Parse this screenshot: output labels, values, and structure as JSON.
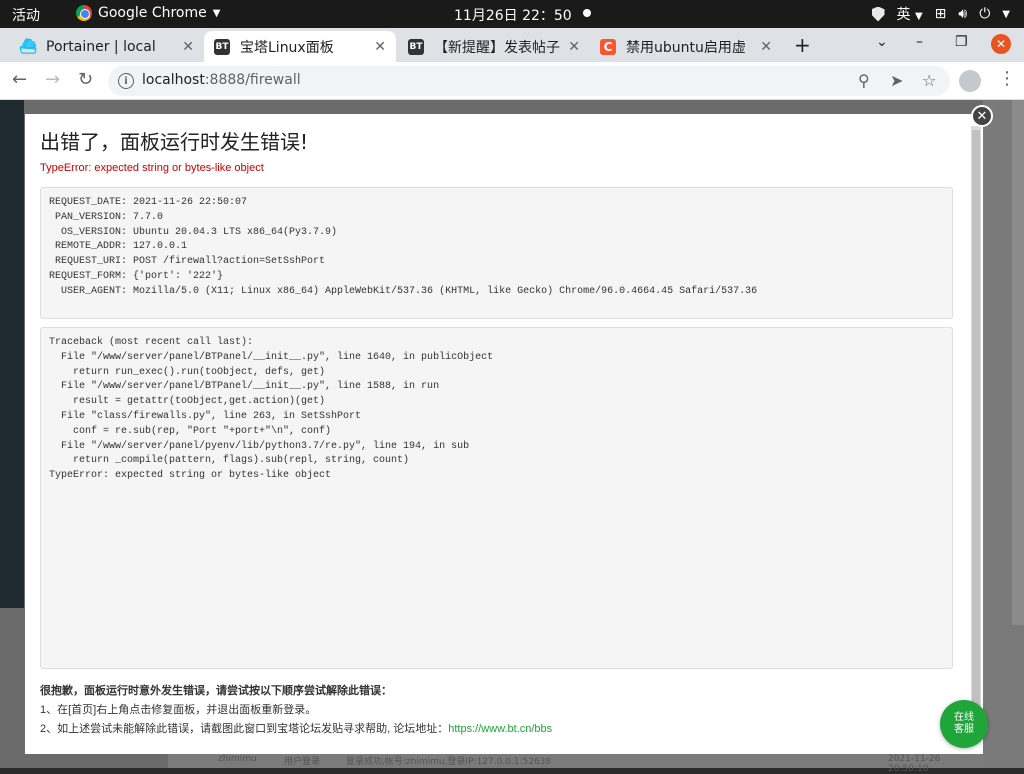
{
  "topbar": {
    "activities": "活动",
    "app_name": "Google Chrome",
    "clock": "11月26日  22：50",
    "ime": "英"
  },
  "tabs": [
    {
      "favicon": "portainer-icon",
      "title": "Portainer | local"
    },
    {
      "favicon": "bt-icon",
      "favicon_text": "BT",
      "title": "宝塔Linux面板",
      "active": true
    },
    {
      "favicon": "bt-icon",
      "favicon_text": "BT",
      "title": "【新提醒】发表帖子"
    },
    {
      "favicon": "csdn-icon",
      "favicon_text": "C",
      "title": "禁用ubuntu启用虚"
    }
  ],
  "address": {
    "host": "localhost",
    "rest": ":8888/firewall"
  },
  "modal": {
    "title": "出错了，面板运行时发生错误!",
    "error": "TypeError: expected string or bytes-like object",
    "request_info": "REQUEST_DATE: 2021-11-26 22:50:07\n PAN_VERSION: 7.7.0\n  OS_VERSION: Ubuntu 20.04.3 LTS x86_64(Py3.7.9)\n REMOTE_ADDR: 127.0.0.1\n REQUEST_URI: POST /firewall?action=SetSshPort\nREQUEST_FORM: {'port': '222'}\n  USER_AGENT: Mozilla/5.0 (X11; Linux x86_64) AppleWebKit/537.36 (KHTML, like Gecko) Chrome/96.0.4664.45 Safari/537.36",
    "traceback": "Traceback (most recent call last):\n  File \"/www/server/panel/BTPanel/__init__.py\", line 1640, in publicObject\n    return run_exec().run(toObject, defs, get)\n  File \"/www/server/panel/BTPanel/__init__.py\", line 1588, in run\n    result = getattr(toObject,get.action)(get)\n  File \"class/firewalls.py\", line 263, in SetSshPort\n    conf = re.sub(rep, \"Port \"+port+\"\\n\", conf)\n  File \"/www/server/panel/pyenv/lib/python3.7/re.py\", line 194, in sub\n    return _compile(pattern, flags).sub(repl, string, count)\nTypeError: expected string or bytes-like object",
    "help_heading": "很抱歉，面板运行时意外发生错误，请尝试按以下顺序尝试解除此错误：",
    "help_1": "1、在[首页]右上角点击修复面板，并退出面板重新登录。",
    "help_2": "2、如上述尝试未能解除此错误，请截图此窗口到宝塔论坛发贴寻求帮助, 论坛地址：",
    "forum_link": "https://www.bt.cn/bbs"
  },
  "online_service": {
    "line1": "在线",
    "line2": "客服"
  },
  "background_row": {
    "user": "zhimimu",
    "type": "用户登录",
    "detail": "登录成功,帐号:zhimimu,登录IP:127.0.0.1:52638",
    "time": "2021-11-26 20:50:10"
  },
  "colors": {
    "accent_green": "#20a53a",
    "error_red": "#cc0000",
    "ubuntu_orange": "#e95420"
  }
}
